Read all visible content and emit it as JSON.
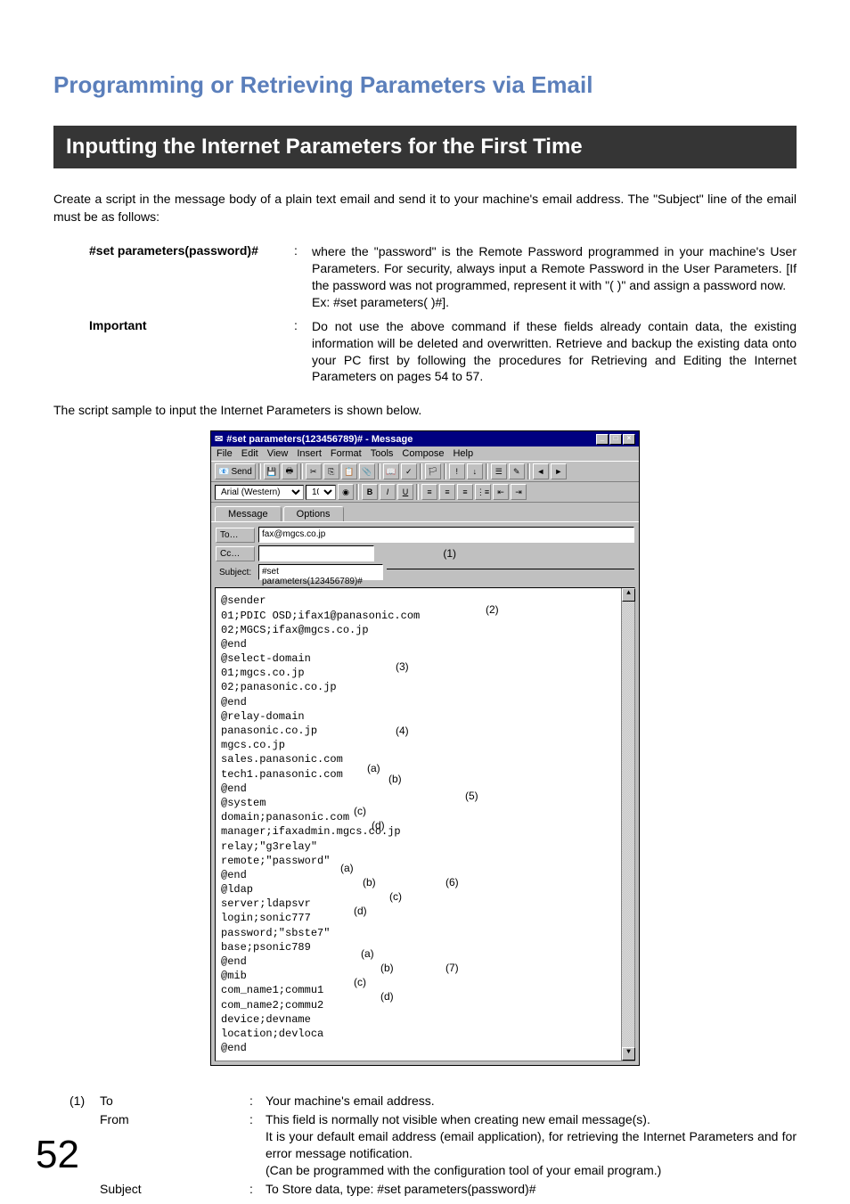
{
  "page_title": "Programming or Retrieving Parameters via Email",
  "section_header": "Inputting the Internet Parameters for the First Time",
  "intro": "Create a script in the message body of a plain text email and send it to your machine's email address.  The \"Subject\" line of the email must be as follows:",
  "params": {
    "set_label": "#set parameters(password)#",
    "set_desc": "where the \"password\" is the Remote Password programmed in your machine's User Parameters.  For security, always input a Remote Password in the User Parameters. [If the password was not programmed, represent it with \"( )\" and assign a password now.",
    "set_example": "Ex: #set parameters( )#].",
    "important_label": "Important",
    "important_desc": "Do not use the above command if these fields already contain data, the existing information will be deleted and overwritten.  Retrieve and backup the existing data onto your PC first by following the procedures for Retrieving and Editing the Internet Parameters on pages 54 to 57."
  },
  "sample_text": "The script sample to input the Internet Parameters is shown below.",
  "email": {
    "title": "#set parameters(123456789)# - Message",
    "menu": [
      "File",
      "Edit",
      "View",
      "Insert",
      "Format",
      "Tools",
      "Compose",
      "Help"
    ],
    "send": "Send",
    "font_name": "Arial (Western)",
    "font_size": "10",
    "tab_message": "Message",
    "tab_options": "Options",
    "to_label": "To…",
    "to_value": "fax@mgcs.co.jp",
    "cc_label": "Cc…",
    "cc_value": "",
    "subject_label": "Subject:",
    "subject_value": "#set parameters(123456789)#",
    "body": [
      "@sender",
      "01;PDIC OSD;ifax1@panasonic.com",
      "02;MGCS;ifax@mgcs.co.jp",
      "@end",
      "@select-domain",
      "01;mgcs.co.jp",
      "02;panasonic.co.jp",
      "@end",
      "@relay-domain",
      "panasonic.co.jp",
      "mgcs.co.jp",
      "sales.panasonic.com",
      "tech1.panasonic.com",
      "@end",
      "@system",
      "domain;panasonic.com",
      "manager;ifaxadmin.mgcs.co.jp",
      "relay;\"g3relay\"",
      "remote;\"password\"",
      "@end",
      "@ldap",
      "server;ldapsvr",
      "login;sonic777",
      "password;\"sbste7\"",
      "base;psonic789",
      "@end",
      "@mib",
      "com_name1;commu1",
      "com_name2;commu2",
      "device;devname",
      "location;devloca",
      "@end"
    ],
    "annotations": {
      "m1": "(1)",
      "m2": "(2)",
      "m3": "(3)",
      "m4": "(4)",
      "m5": "(5)",
      "m6": "(6)",
      "m7": "(7)",
      "a": "(a)",
      "b": "(b)",
      "c": "(c)",
      "d": "(d)"
    }
  },
  "legend": {
    "r1_num": "(1)",
    "r1_label": "To",
    "r1_desc": "Your machine's email address.",
    "r2_label": "From",
    "r2_desc1": "This field is normally not visible when creating new email message(s).",
    "r2_desc2": "It is your default email address (email application), for retrieving the Internet Parameters and for error message notification.",
    "r2_desc3": "(Can be programmed with the configuration tool of your email program.)",
    "r3_label": "Subject",
    "r3_desc": "To Store data, type: #set parameters(password)#"
  },
  "page_number": "52"
}
